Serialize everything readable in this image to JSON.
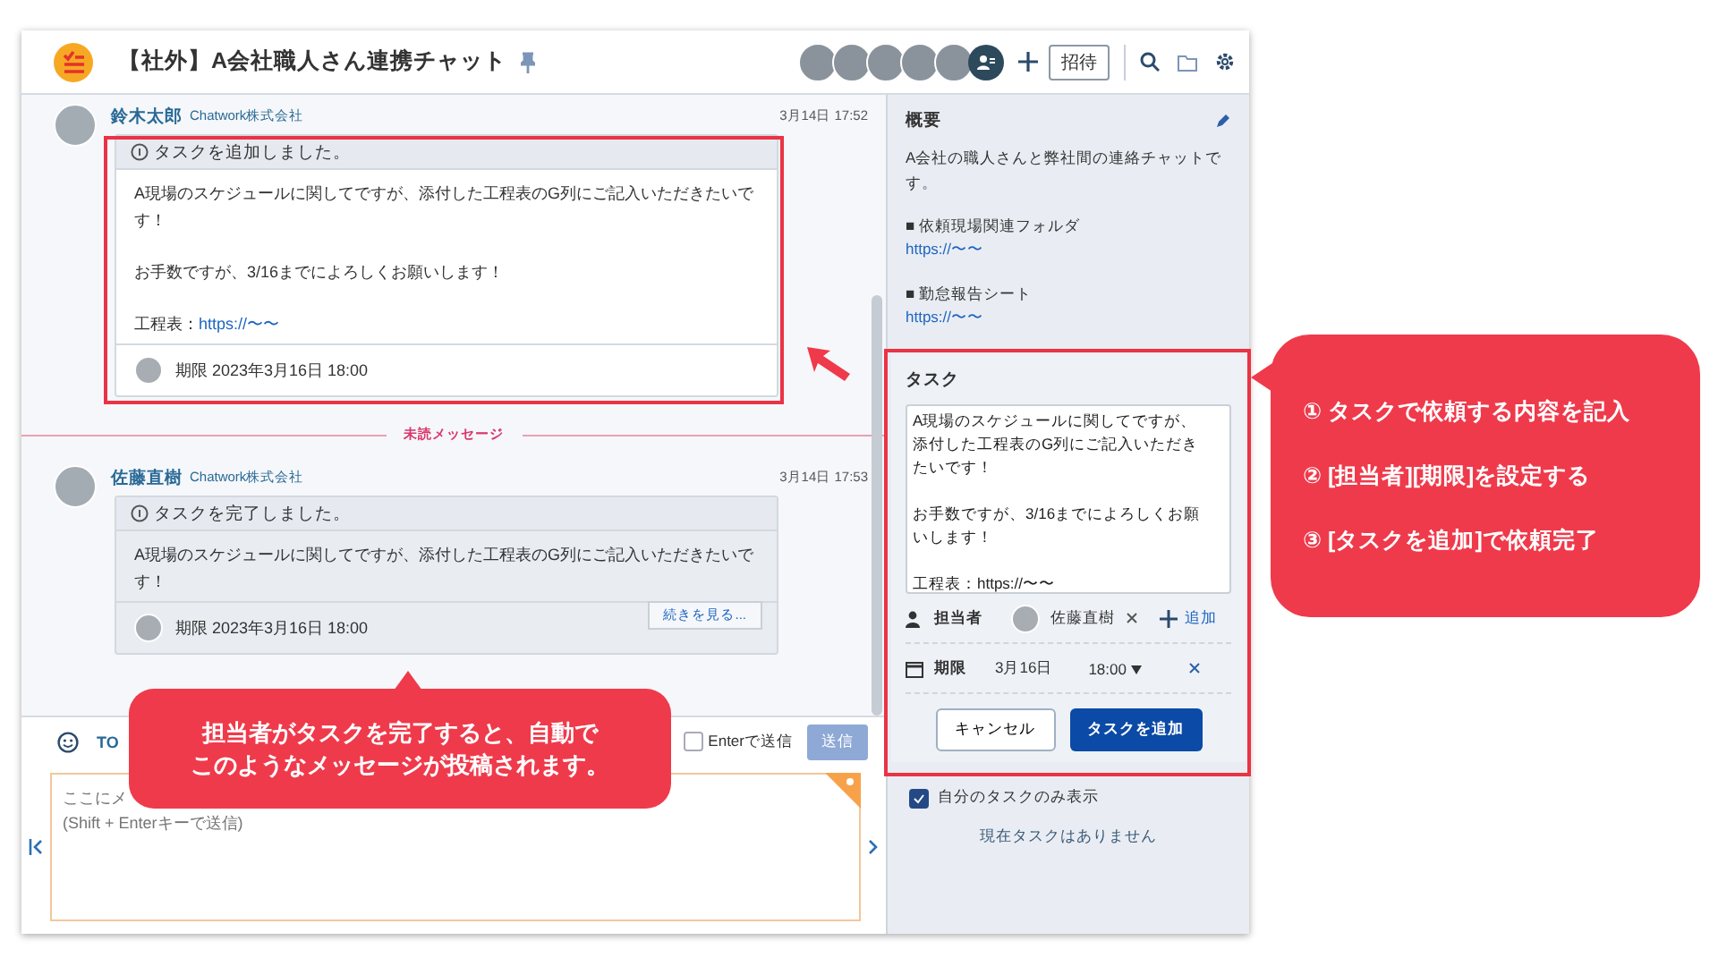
{
  "header": {
    "title": "【社外】A会社職人さん連携チャット",
    "invite_button": "招待"
  },
  "messages": [
    {
      "sender": "鈴木太郎",
      "company": "Chatwork株式会社",
      "time": "3月14日 17:52",
      "task_card": {
        "kind": "added",
        "notice": "タスクを追加しました。",
        "body": [
          "A現場のスケジュールに関してですが、添付した工程表のG列にご記入いただきたいです！",
          "お手数ですが、3/16までによろしくお願いします！"
        ],
        "link_label": "工程表：",
        "link": "https://〜〜",
        "deadline": "期限 2023年3月16日 18:00"
      }
    },
    {
      "sender": "佐藤直樹",
      "company": "Chatwork株式会社",
      "time": "3月14日 17:53",
      "task_card": {
        "kind": "completed",
        "notice": "タスクを完了しました。",
        "body": [
          "A現場のスケジュールに関してですが、添付した工程表のG列にご記入いただきたいです！"
        ],
        "more_button": "続きを見る...",
        "deadline": "期限 2023年3月16日 18:00"
      }
    }
  ],
  "unread_divider": "未読メッセージ",
  "composer": {
    "to_label": "TO",
    "enter_to_send": {
      "label": "Enterで送信",
      "checked": false
    },
    "send_button": {
      "label": "送信",
      "disabled": true
    },
    "placeholder": "ここにメ\n(Shift + Enterキーで送信)"
  },
  "sidebar": {
    "overview": {
      "title": "概要",
      "description": "A会社の職人さんと弊社間の連絡チャットです。",
      "links": [
        {
          "label": "■ 依頼現場関連フォルダ",
          "url": "https://〜〜"
        },
        {
          "label": "■ 勤怠報告シート",
          "url": "https://〜〜"
        }
      ]
    },
    "task_form": {
      "title": "タスク",
      "text": [
        "A現場のスケジュールに関してですが、添付した工程表のG列にご記入いただきたいです！",
        "お手数ですが、3/16までによろしくお願いします！",
        "工程表：https://〜〜"
      ],
      "assignee_label": "担当者",
      "assignee": "佐藤直樹",
      "add_label": "追加",
      "deadline_label": "期限",
      "date": "3月16日",
      "time": "18:00",
      "cancel_button": "キャンセル",
      "submit_button": "タスクを追加"
    },
    "my_tasks_only": {
      "label": "自分のタスクのみ表示",
      "checked": true
    },
    "empty_text": "現在タスクはありません"
  },
  "annotations": {
    "steps": [
      "① タスクで依頼する内容を記入",
      "② [担当者][期限]を設定する",
      "③ [タスクを追加]で依頼完了"
    ],
    "note": [
      "担当者がタスクを完了すると、自動で",
      "このようなメッセージが投稿されます。"
    ]
  }
}
